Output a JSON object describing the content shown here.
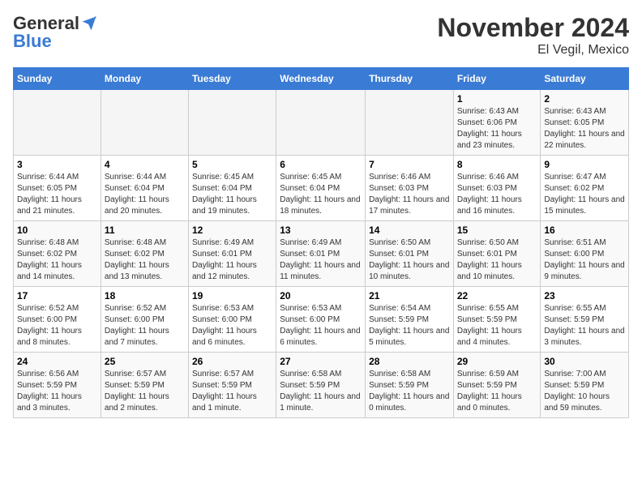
{
  "logo": {
    "general": "General",
    "blue": "Blue"
  },
  "header": {
    "month": "November 2024",
    "location": "El Vegil, Mexico"
  },
  "weekdays": [
    "Sunday",
    "Monday",
    "Tuesday",
    "Wednesday",
    "Thursday",
    "Friday",
    "Saturday"
  ],
  "weeks": [
    [
      {
        "day": "",
        "info": ""
      },
      {
        "day": "",
        "info": ""
      },
      {
        "day": "",
        "info": ""
      },
      {
        "day": "",
        "info": ""
      },
      {
        "day": "",
        "info": ""
      },
      {
        "day": "1",
        "info": "Sunrise: 6:43 AM\nSunset: 6:06 PM\nDaylight: 11 hours and 23 minutes."
      },
      {
        "day": "2",
        "info": "Sunrise: 6:43 AM\nSunset: 6:05 PM\nDaylight: 11 hours and 22 minutes."
      }
    ],
    [
      {
        "day": "3",
        "info": "Sunrise: 6:44 AM\nSunset: 6:05 PM\nDaylight: 11 hours and 21 minutes."
      },
      {
        "day": "4",
        "info": "Sunrise: 6:44 AM\nSunset: 6:04 PM\nDaylight: 11 hours and 20 minutes."
      },
      {
        "day": "5",
        "info": "Sunrise: 6:45 AM\nSunset: 6:04 PM\nDaylight: 11 hours and 19 minutes."
      },
      {
        "day": "6",
        "info": "Sunrise: 6:45 AM\nSunset: 6:04 PM\nDaylight: 11 hours and 18 minutes."
      },
      {
        "day": "7",
        "info": "Sunrise: 6:46 AM\nSunset: 6:03 PM\nDaylight: 11 hours and 17 minutes."
      },
      {
        "day": "8",
        "info": "Sunrise: 6:46 AM\nSunset: 6:03 PM\nDaylight: 11 hours and 16 minutes."
      },
      {
        "day": "9",
        "info": "Sunrise: 6:47 AM\nSunset: 6:02 PM\nDaylight: 11 hours and 15 minutes."
      }
    ],
    [
      {
        "day": "10",
        "info": "Sunrise: 6:48 AM\nSunset: 6:02 PM\nDaylight: 11 hours and 14 minutes."
      },
      {
        "day": "11",
        "info": "Sunrise: 6:48 AM\nSunset: 6:02 PM\nDaylight: 11 hours and 13 minutes."
      },
      {
        "day": "12",
        "info": "Sunrise: 6:49 AM\nSunset: 6:01 PM\nDaylight: 11 hours and 12 minutes."
      },
      {
        "day": "13",
        "info": "Sunrise: 6:49 AM\nSunset: 6:01 PM\nDaylight: 11 hours and 11 minutes."
      },
      {
        "day": "14",
        "info": "Sunrise: 6:50 AM\nSunset: 6:01 PM\nDaylight: 11 hours and 10 minutes."
      },
      {
        "day": "15",
        "info": "Sunrise: 6:50 AM\nSunset: 6:01 PM\nDaylight: 11 hours and 10 minutes."
      },
      {
        "day": "16",
        "info": "Sunrise: 6:51 AM\nSunset: 6:00 PM\nDaylight: 11 hours and 9 minutes."
      }
    ],
    [
      {
        "day": "17",
        "info": "Sunrise: 6:52 AM\nSunset: 6:00 PM\nDaylight: 11 hours and 8 minutes."
      },
      {
        "day": "18",
        "info": "Sunrise: 6:52 AM\nSunset: 6:00 PM\nDaylight: 11 hours and 7 minutes."
      },
      {
        "day": "19",
        "info": "Sunrise: 6:53 AM\nSunset: 6:00 PM\nDaylight: 11 hours and 6 minutes."
      },
      {
        "day": "20",
        "info": "Sunrise: 6:53 AM\nSunset: 6:00 PM\nDaylight: 11 hours and 6 minutes."
      },
      {
        "day": "21",
        "info": "Sunrise: 6:54 AM\nSunset: 5:59 PM\nDaylight: 11 hours and 5 minutes."
      },
      {
        "day": "22",
        "info": "Sunrise: 6:55 AM\nSunset: 5:59 PM\nDaylight: 11 hours and 4 minutes."
      },
      {
        "day": "23",
        "info": "Sunrise: 6:55 AM\nSunset: 5:59 PM\nDaylight: 11 hours and 3 minutes."
      }
    ],
    [
      {
        "day": "24",
        "info": "Sunrise: 6:56 AM\nSunset: 5:59 PM\nDaylight: 11 hours and 3 minutes."
      },
      {
        "day": "25",
        "info": "Sunrise: 6:57 AM\nSunset: 5:59 PM\nDaylight: 11 hours and 2 minutes."
      },
      {
        "day": "26",
        "info": "Sunrise: 6:57 AM\nSunset: 5:59 PM\nDaylight: 11 hours and 1 minute."
      },
      {
        "day": "27",
        "info": "Sunrise: 6:58 AM\nSunset: 5:59 PM\nDaylight: 11 hours and 1 minute."
      },
      {
        "day": "28",
        "info": "Sunrise: 6:58 AM\nSunset: 5:59 PM\nDaylight: 11 hours and 0 minutes."
      },
      {
        "day": "29",
        "info": "Sunrise: 6:59 AM\nSunset: 5:59 PM\nDaylight: 11 hours and 0 minutes."
      },
      {
        "day": "30",
        "info": "Sunrise: 7:00 AM\nSunset: 5:59 PM\nDaylight: 10 hours and 59 minutes."
      }
    ]
  ]
}
